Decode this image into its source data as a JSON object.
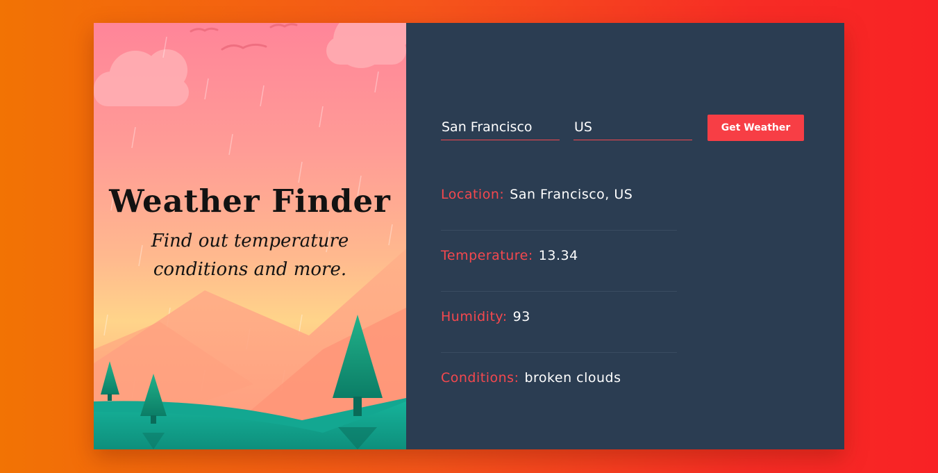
{
  "app": {
    "title": "Weather Finder",
    "subtitle": "Find out temperature conditions and more."
  },
  "form": {
    "city_value": "San Francisco",
    "country_value": "US",
    "submit_label": "Get Weather"
  },
  "results": [
    {
      "label": "Location:",
      "value": "San Francisco, US"
    },
    {
      "label": "Temperature:",
      "value": "13.34"
    },
    {
      "label": "Humidity:",
      "value": "93"
    },
    {
      "label": "Conditions:",
      "value": "broken clouds"
    }
  ],
  "colors": {
    "accent": "#f73e45",
    "panel": "#2b3d52",
    "background_start": "#f27304",
    "background_end": "#f82225"
  }
}
